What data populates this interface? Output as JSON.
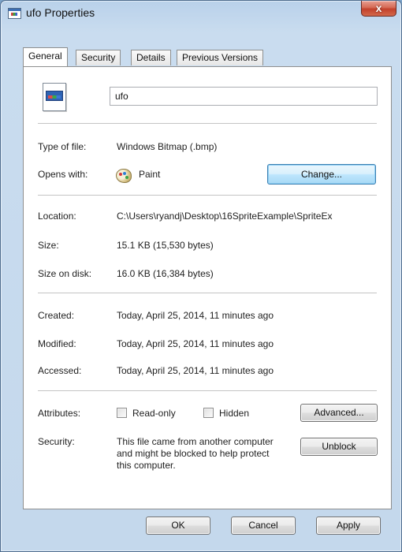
{
  "window": {
    "title": "ufo Properties",
    "close_label": "x"
  },
  "tabs": [
    {
      "label": "General"
    },
    {
      "label": "Security"
    },
    {
      "label": "Details"
    },
    {
      "label": "Previous Versions"
    }
  ],
  "general": {
    "file_name": "ufo",
    "type_label": "Type of file:",
    "type_value": "Windows Bitmap (.bmp)",
    "opens_label": "Opens with:",
    "opens_value": "Paint",
    "change_button": "Change...",
    "location_label": "Location:",
    "location_value": "C:\\Users\\ryandj\\Desktop\\16SpriteExample\\SpriteEx",
    "size_label": "Size:",
    "size_value": "15.1 KB (15,530 bytes)",
    "size_disk_label": "Size on disk:",
    "size_disk_value": "16.0 KB (16,384 bytes)",
    "created_label": "Created:",
    "created_value": "Today, April 25, 2014, 11 minutes ago",
    "modified_label": "Modified:",
    "modified_value": "Today, April 25, 2014, 11 minutes ago",
    "accessed_label": "Accessed:",
    "accessed_value": "Today, April 25, 2014, 11 minutes ago",
    "attributes_label": "Attributes:",
    "readonly_label": "Read-only",
    "hidden_label": "Hidden",
    "advanced_button": "Advanced...",
    "security_label": "Security:",
    "security_text": "This file came from another computer and might be blocked to help protect this computer.",
    "unblock_button": "Unblock"
  },
  "footer": {
    "ok": "OK",
    "cancel": "Cancel",
    "apply": "Apply"
  },
  "colors": {
    "frame": "#b9d1ea",
    "close": "#c2412b",
    "focus": "#3c7fb1"
  },
  "icons": {
    "app": "bitmap-file-icon",
    "opens_with": "paint-icon",
    "close": "close-icon"
  }
}
